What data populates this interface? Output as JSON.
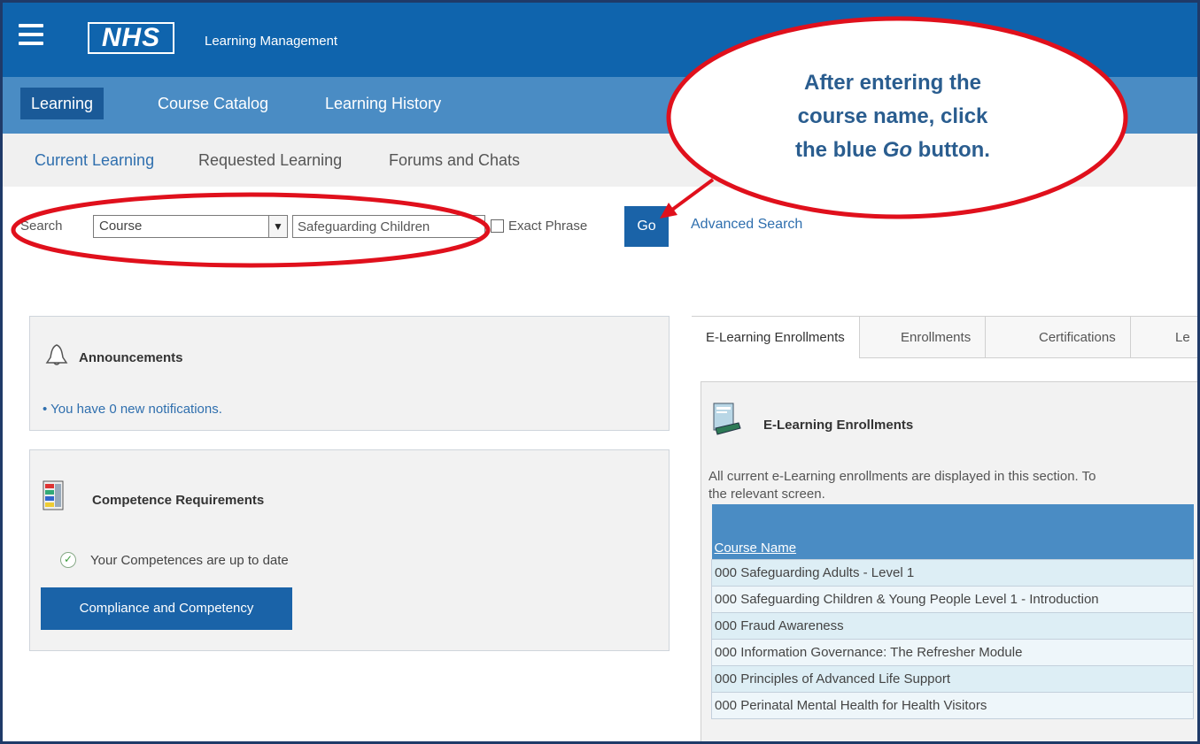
{
  "app": {
    "logo": "NHS",
    "title": "Learning Management"
  },
  "nav": {
    "tabs": [
      {
        "label": "Learning",
        "active": true
      },
      {
        "label": "Course Catalog",
        "active": false
      },
      {
        "label": "Learning History",
        "active": false
      }
    ]
  },
  "subnav": {
    "links": [
      {
        "label": "Current Learning",
        "active": true
      },
      {
        "label": "Requested Learning",
        "active": false
      },
      {
        "label": "Forums and Chats",
        "active": false
      }
    ]
  },
  "search": {
    "label": "Search",
    "type_value": "Course",
    "query_value": "Safeguarding Children",
    "exact_phrase_label": "Exact Phrase",
    "exact_phrase_checked": false,
    "go_label": "Go",
    "advanced_label": "Advanced Search"
  },
  "announcements": {
    "title": "Announcements",
    "items": [
      "You have 0 new notifications."
    ]
  },
  "competence": {
    "title": "Competence Requirements",
    "status": "Your Competences are up to date",
    "button_label": "Compliance and Competency"
  },
  "enrollment_tabs": [
    {
      "label": "E-Learning Enrollments",
      "active": true
    },
    {
      "label": "Enrollments",
      "active": false
    },
    {
      "label": "Certifications",
      "active": false
    },
    {
      "label": "Le",
      "active": false
    }
  ],
  "elearning": {
    "title": "E-Learning Enrollments",
    "description": "All current e-Learning enrollments are displayed in this section. To",
    "description_line2": "the relevant screen.",
    "column_header": "Course Name",
    "courses": [
      "000 Safeguarding Adults - Level 1",
      "000 Safeguarding Children & Young People Level 1 - Introduction",
      "000 Fraud Awareness",
      "000 Information Governance: The Refresher Module",
      "000 Principles of Advanced Life Support",
      "000 Perinatal Mental Health for Health Visitors"
    ]
  },
  "callout": {
    "line1": "After entering the",
    "line2": "course name, click",
    "line3_pre": "the blue ",
    "line3_em": "Go",
    "line3_post": " button."
  },
  "colors": {
    "header_blue": "#0f64ad",
    "nav_blue": "#4a8cc4",
    "button_blue": "#1a63a8",
    "annotation_red": "#e0101c"
  }
}
